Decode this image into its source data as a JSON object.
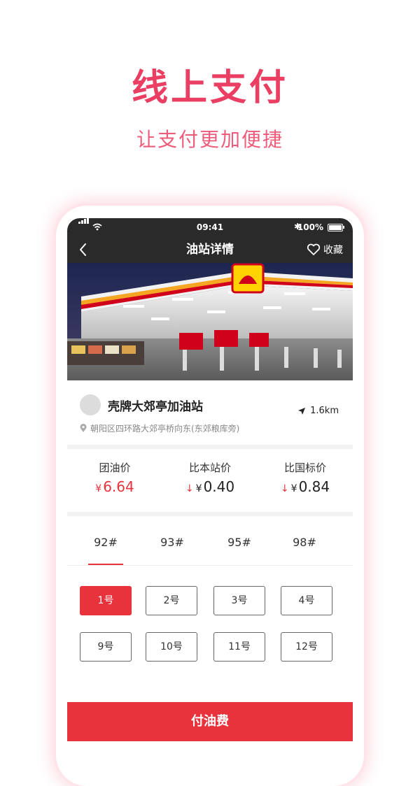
{
  "hero": {
    "title": "线上支付",
    "subtitle": "让支付更加便捷"
  },
  "status_bar": {
    "time": "09:41",
    "battery": "100%",
    "bluetooth_glyph": "✱"
  },
  "nav": {
    "title": "油站详情",
    "favorite_label": "收藏"
  },
  "station": {
    "name": "壳牌大郊亭加油站",
    "distance": "1.6km",
    "address": "朝阳区四环路大郊亭桥向东(东郊粮库旁)"
  },
  "prices": [
    {
      "label": "团油价",
      "currency": "¥",
      "value": "6.64",
      "arrow": ""
    },
    {
      "label": "比本站价",
      "currency": "¥",
      "value": "0.40",
      "arrow": "↓"
    },
    {
      "label": "比国标价",
      "currency": "¥",
      "value": "0.84",
      "arrow": "↓"
    }
  ],
  "fuel_grades": [
    "92#",
    "93#",
    "95#",
    "98#"
  ],
  "selected_grade": "92#",
  "pumps": [
    "1号",
    "2号",
    "3号",
    "4号",
    "9号",
    "10号",
    "11号",
    "12号"
  ],
  "selected_pump": "1号",
  "pay_button": "付油费",
  "colors": {
    "brand_red": "#e8323c",
    "hero_pink": "#ea3e62",
    "nav_dark": "#2a2a2a"
  }
}
